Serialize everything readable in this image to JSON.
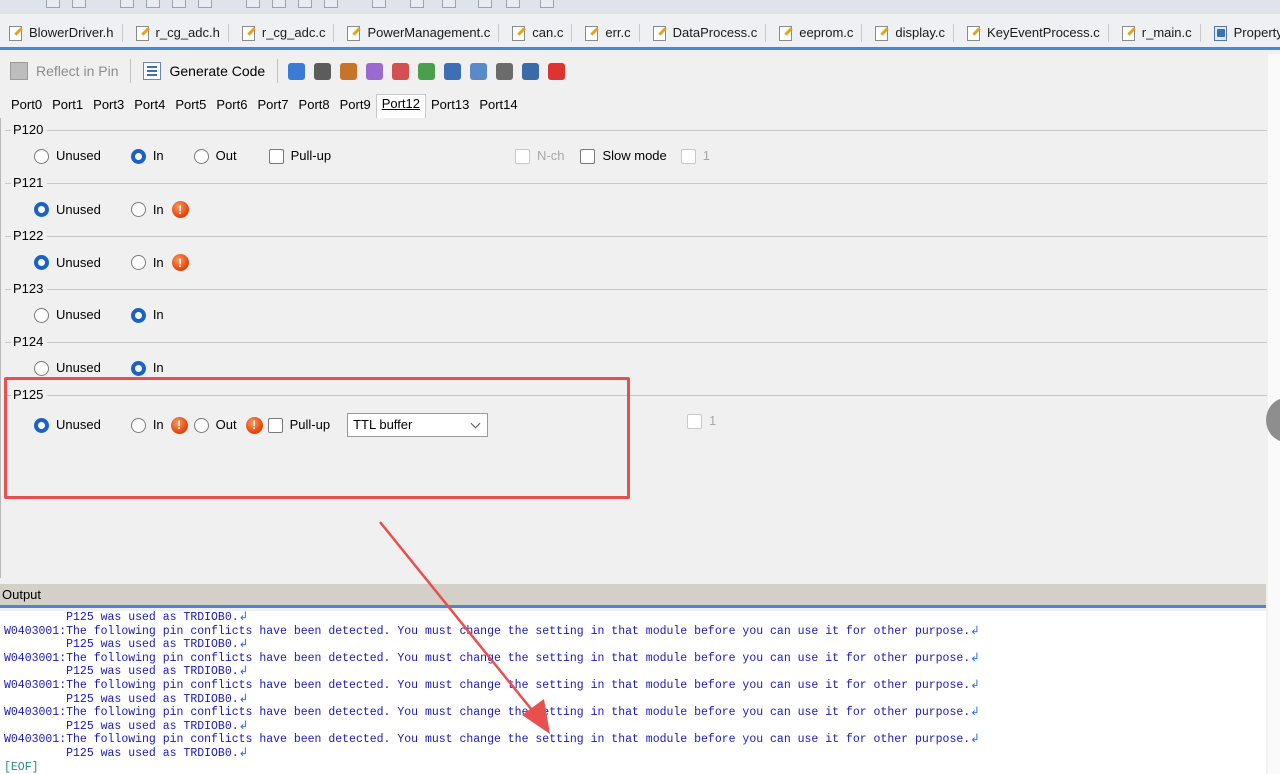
{
  "file_tabs": [
    {
      "label": "BlowerDriver.h",
      "icon": "c-file-icon"
    },
    {
      "label": "r_cg_adc.h",
      "icon": "c-file-icon"
    },
    {
      "label": "r_cg_adc.c",
      "icon": "c-file-icon"
    },
    {
      "label": "PowerManagement.c",
      "icon": "c-file-icon"
    },
    {
      "label": "can.c",
      "icon": "c-file-icon"
    },
    {
      "label": "err.c",
      "icon": "c-file-icon"
    },
    {
      "label": "DataProcess.c",
      "icon": "c-file-icon"
    },
    {
      "label": "eeprom.c",
      "icon": "c-file-icon"
    },
    {
      "label": "display.c",
      "icon": "c-file-icon"
    },
    {
      "label": "KeyEventProcess.c",
      "icon": "c-file-icon"
    },
    {
      "label": "r_main.c",
      "icon": "c-file-icon"
    },
    {
      "label": "Property",
      "icon": "property-icon"
    }
  ],
  "toolbar": {
    "reflect_label": "Reflect in Pin",
    "generate_label": "Generate Code"
  },
  "port_tabs": [
    "Port0",
    "Port1",
    "Port3",
    "Port4",
    "Port5",
    "Port6",
    "Port7",
    "Port8",
    "Port9",
    "Port12",
    "Port13",
    "Port14"
  ],
  "active_port_tab": "Port12",
  "pins": {
    "p120": {
      "label": "P120",
      "unused": "Unused",
      "in": "In",
      "out": "Out",
      "pullup": "Pull-up",
      "nch": "N-ch",
      "slow": "Slow mode",
      "one": "1",
      "selected": "In"
    },
    "p121": {
      "label": "P121",
      "unused": "Unused",
      "in": "In",
      "selected": "Unused",
      "warning": "!"
    },
    "p122": {
      "label": "P122",
      "unused": "Unused",
      "in": "In",
      "selected": "Unused",
      "warning": "!"
    },
    "p123": {
      "label": "P123",
      "unused": "Unused",
      "in": "In",
      "selected": "In"
    },
    "p124": {
      "label": "P124",
      "unused": "Unused",
      "in": "In",
      "selected": "In"
    },
    "p125": {
      "label": "P125",
      "unused": "Unused",
      "in": "In",
      "out": "Out",
      "pullup": "Pull-up",
      "buffer": "TTL buffer",
      "one": "1",
      "selected": "Unused",
      "warning": "!"
    }
  },
  "output": {
    "title": "Output",
    "lines": [
      "         P125 was used as TRDIOB0.",
      "W0403001:The following pin conflicts have been detected. You must change the setting in that module before you can use it for other purpose.",
      "         P125 was used as TRDIOB0.",
      "W0403001:The following pin conflicts have been detected. You must change the setting in that module before you can use it for other purpose.",
      "         P125 was used as TRDIOB0.",
      "W0403001:The following pin conflicts have been detected. You must change the setting in that module before you can use it for other purpose.",
      "         P125 was used as TRDIOB0.",
      "W0403001:The following pin conflicts have been detected. You must change the setting in that module before you can use it for other purpose.",
      "         P125 was used as TRDIOB0.",
      "W0403001:The following pin conflicts have been detected. You must change the setting in that module before you can use it for other purpose.",
      "         P125 was used as TRDIOB0."
    ],
    "eof": "[EOF]",
    "return_glyph": "↲"
  },
  "colors": {
    "accent": "#4a86d8",
    "highlight": "#e8504f",
    "warning": "#e2450c",
    "output_text": "#1a1ab4"
  }
}
